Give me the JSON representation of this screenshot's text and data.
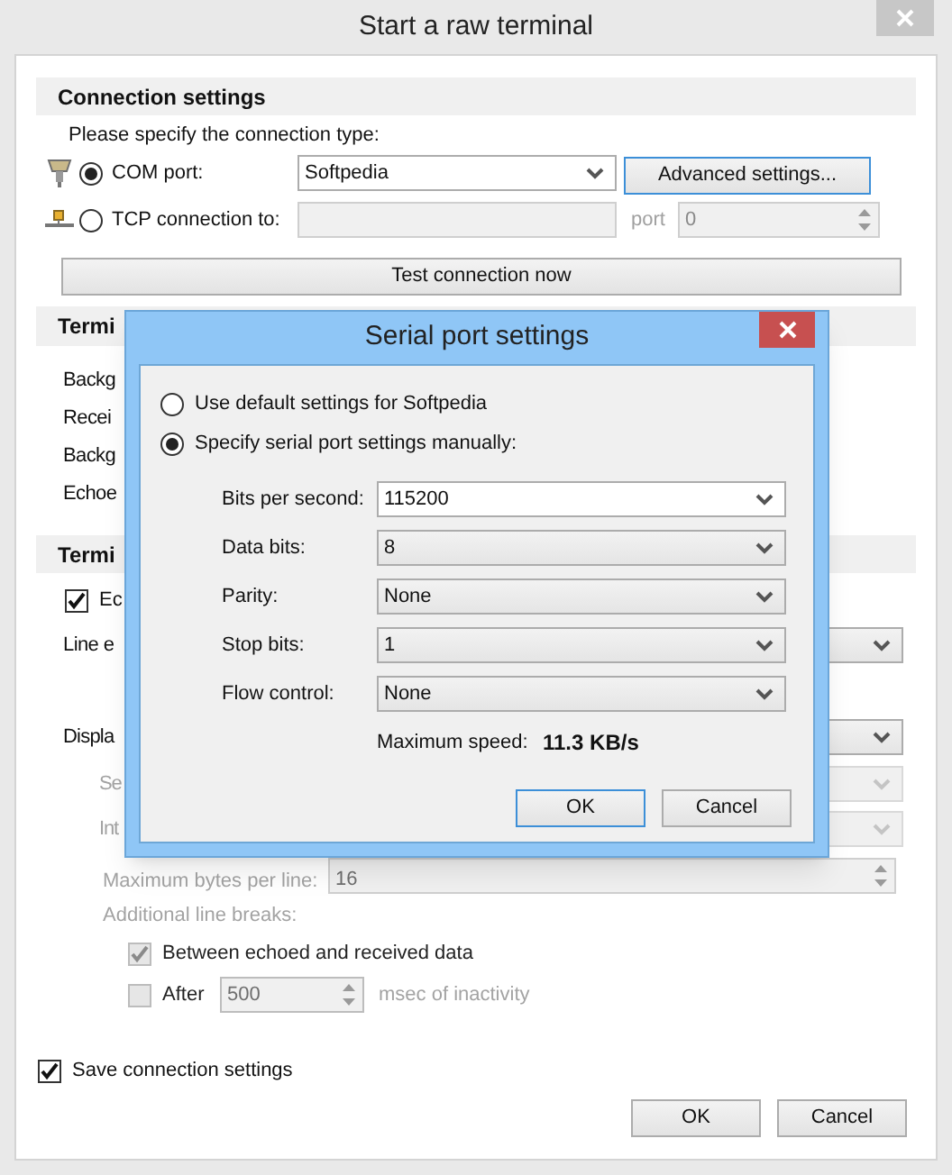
{
  "window": {
    "title": "Start a raw terminal"
  },
  "connection": {
    "heading": "Connection settings",
    "prompt": "Please specify the connection type:",
    "options": [
      {
        "kind": "com",
        "label": "COM port:",
        "selected": true,
        "value": "Softpedia"
      },
      {
        "kind": "tcp",
        "label": "TCP connection to:",
        "selected": false,
        "port_label": "port",
        "port": "0"
      }
    ],
    "advanced_button": "Advanced settings...",
    "test_button": "Test connection now"
  },
  "terminal_colors": {
    "heading": "Termi",
    "labels": [
      "Backg",
      "Recei",
      "Backg",
      "Echoe"
    ]
  },
  "terminal_options": {
    "heading": "Termi",
    "echo": {
      "label": "Ec",
      "checked": true
    },
    "line_ending_label": "Line e",
    "display_label": "Displa",
    "disabled": true,
    "sub_labels": [
      "Se",
      "Int"
    ],
    "max_bytes": {
      "label": "Maximum bytes per line:",
      "value": "16"
    },
    "line_breaks_label": "Additional line breaks:",
    "between": {
      "label": "Between echoed and received data",
      "checked": true
    },
    "after": {
      "label": "After",
      "checked": false,
      "value": "500",
      "suffix": "msec of inactivity"
    }
  },
  "save_settings": {
    "label": "Save connection settings",
    "checked": true
  },
  "buttons": [
    "OK",
    "Cancel"
  ],
  "dialog": {
    "title": "Serial port settings",
    "modes": [
      {
        "label": "Use default settings for Softpedia",
        "selected": false
      },
      {
        "label": "Specify serial port settings manually:",
        "selected": true
      }
    ],
    "fields": [
      {
        "label": "Bits per second:",
        "value": "115200",
        "kind": "combo"
      },
      {
        "label": "Data bits:",
        "value": "8",
        "kind": "list"
      },
      {
        "label": "Parity:",
        "value": "None",
        "kind": "list"
      },
      {
        "label": "Stop bits:",
        "value": "1",
        "kind": "list"
      },
      {
        "label": "Flow control:",
        "value": "None",
        "kind": "list"
      }
    ],
    "speed_label": "Maximum speed:",
    "speed": "11.3 KB/s",
    "buttons": [
      "OK",
      "Cancel"
    ]
  }
}
